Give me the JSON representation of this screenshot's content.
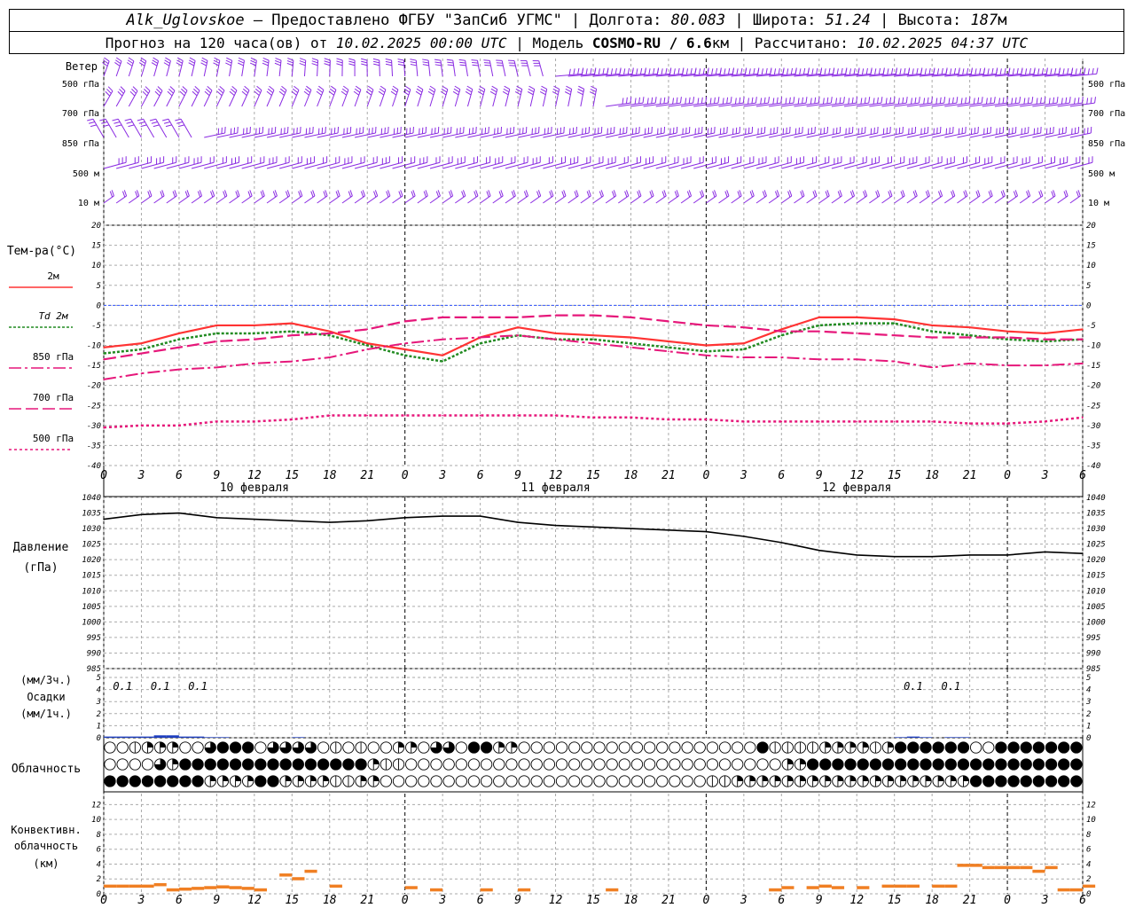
{
  "header": {
    "station": "Alk_Uglovskoe",
    "provider": "– Предоставлено ФГБУ \"ЗапСиб УГМС\" |",
    "lon_label": "Долгота:",
    "lon_value": "80.083",
    "lat_label": "| Широта:",
    "lat_value": "51.24",
    "alt_label": "| Высота:",
    "alt_value": "187",
    "alt_unit": "м",
    "forecast_label": "Прогноз на 120 часа(ов) от",
    "forecast_from": "10.02.2025 00:00 UTC",
    "model_label": "| Модель",
    "model_name": "COSMO-RU / 6.6",
    "model_unit": "км",
    "calc_label": "| Рассчитано:",
    "calc_time": "10.02.2025 04:37 UTC"
  },
  "wind": {
    "title": "Ветер",
    "levels": [
      "500 гПа",
      "700 гПа",
      "850 гПа",
      "500 м",
      "10  м"
    ]
  },
  "temp_panel": {
    "title": "Тем-ра(°С)",
    "legend": [
      {
        "label": "2м",
        "color": "#ff3333",
        "dash": "none"
      },
      {
        "label": "Td 2м",
        "color": "#228b22",
        "dash": "3,2"
      },
      {
        "label": "850 гПа",
        "color": "#e6177a",
        "dash": "14,4,3,4"
      },
      {
        "label": "700 гПа",
        "color": "#e6177a",
        "dash": "14,5"
      },
      {
        "label": "500 гПа",
        "color": "#e6177a",
        "dash": "3,3"
      }
    ],
    "yticks": [
      "20",
      "15",
      "10",
      "5",
      "0",
      "-5",
      "-10",
      "-15",
      "-20",
      "-25",
      "-30",
      "-35",
      "-40"
    ]
  },
  "time_axis": {
    "hours": [
      "0",
      "3",
      "6",
      "9",
      "12",
      "15",
      "18",
      "21",
      "0",
      "3",
      "6",
      "9",
      "12",
      "15",
      "18",
      "21",
      "0",
      "3",
      "6",
      "9",
      "12",
      "15",
      "18",
      "21",
      "0",
      "3",
      "6"
    ],
    "days": [
      "10 февраля",
      "11 февраля",
      "12 февраля"
    ]
  },
  "pressure_panel": {
    "title": "Давление",
    "unit": "(гПа)",
    "yticks": [
      "1040",
      "1035",
      "1030",
      "1025",
      "1020",
      "1015",
      "1010",
      "1005",
      "1000",
      "995",
      "990",
      "985"
    ]
  },
  "precip_panel": {
    "label1": "(мм/3ч.)",
    "label2": "Осадки",
    "label3": "(мм/1ч.)",
    "yticks": [
      "5",
      "4",
      "3",
      "2",
      "1",
      "0"
    ],
    "amounts": [
      {
        "hour": 1.5,
        "text": "0.1"
      },
      {
        "hour": 4.5,
        "text": "0.1"
      },
      {
        "hour": 7.5,
        "text": "0.1"
      },
      {
        "hour": 64.5,
        "text": "0.1"
      },
      {
        "hour": 67.5,
        "text": "0.1"
      }
    ]
  },
  "cloud_panel": {
    "title": "Облачность"
  },
  "conv_panel": {
    "title1": "Конвективн.",
    "title2": "облачность",
    "title3": "(км)",
    "yticks": [
      "12",
      "10",
      "8",
      "6",
      "4",
      "2",
      "0"
    ]
  },
  "chart_data": [
    {
      "type": "line",
      "title": "Тем-ра(°С)",
      "x_unit": "hours from 10.02.2025 00:00 UTC",
      "ylim": [
        -40,
        20
      ],
      "series": [
        {
          "name": "2м",
          "x": [
            0,
            3,
            6,
            9,
            12,
            15,
            18,
            21,
            24,
            27,
            30,
            33,
            36,
            39,
            42,
            45,
            48,
            51,
            54,
            57,
            60,
            63,
            66,
            69,
            72,
            75,
            78
          ],
          "values": [
            -10.5,
            -9.5,
            -7,
            -5,
            -5,
            -4.5,
            -6.5,
            -9.5,
            -11,
            -12.5,
            -8,
            -5.5,
            -7,
            -7.5,
            -8,
            -9,
            -10,
            -9.5,
            -6,
            -3,
            -3,
            -3.5,
            -5,
            -5.5,
            -6.5,
            -7,
            -6
          ]
        },
        {
          "name": "Td 2м",
          "x": [
            0,
            3,
            6,
            9,
            12,
            15,
            18,
            21,
            24,
            27,
            30,
            33,
            36,
            39,
            42,
            45,
            48,
            51,
            54,
            57,
            60,
            63,
            66,
            69,
            72,
            75,
            78
          ],
          "values": [
            -12,
            -11,
            -8.5,
            -7,
            -7,
            -6.5,
            -7.5,
            -10,
            -12.5,
            -14,
            -9.5,
            -7.5,
            -8.5,
            -8.5,
            -9.5,
            -10.5,
            -11.5,
            -11,
            -7.5,
            -5,
            -4.5,
            -4.5,
            -6.5,
            -7.5,
            -8.5,
            -9,
            -8.5
          ]
        },
        {
          "name": "850 гПа",
          "x": [
            0,
            3,
            6,
            9,
            12,
            15,
            18,
            21,
            24,
            27,
            30,
            33,
            36,
            39,
            42,
            45,
            48,
            51,
            54,
            57,
            60,
            63,
            66,
            69,
            72,
            75,
            78
          ],
          "values": [
            -18.5,
            -17,
            -16,
            -15.5,
            -14.5,
            -14,
            -13,
            -11,
            -9.5,
            -8.5,
            -8,
            -7.5,
            -8.5,
            -9.5,
            -10.5,
            -11.5,
            -12.5,
            -13,
            -13,
            -13.5,
            -13.5,
            -14,
            -15.5,
            -14.5,
            -15,
            -15,
            -14.5
          ]
        },
        {
          "name": "700 гПа",
          "x": [
            0,
            3,
            6,
            9,
            12,
            15,
            18,
            21,
            24,
            27,
            30,
            33,
            36,
            39,
            42,
            45,
            48,
            51,
            54,
            57,
            60,
            63,
            66,
            69,
            72,
            75,
            78
          ],
          "values": [
            -13.5,
            -12,
            -10.5,
            -9,
            -8.5,
            -7.5,
            -7,
            -6,
            -4,
            -3,
            -3,
            -3,
            -2.5,
            -2.5,
            -3,
            -4,
            -5,
            -5.5,
            -6.5,
            -6.5,
            -7,
            -7.5,
            -8,
            -8,
            -8,
            -8.5,
            -8.5
          ]
        },
        {
          "name": "500 гПа",
          "x": [
            0,
            3,
            6,
            9,
            12,
            15,
            18,
            21,
            24,
            27,
            30,
            33,
            36,
            39,
            42,
            45,
            48,
            51,
            54,
            57,
            60,
            63,
            66,
            69,
            72,
            75,
            78
          ],
          "values": [
            -30.5,
            -30,
            -30,
            -29,
            -29,
            -28.5,
            -27.5,
            -27.5,
            -27.5,
            -27.5,
            -27.5,
            -27.5,
            -27.5,
            -28,
            -28,
            -28.5,
            -28.5,
            -29,
            -29,
            -29,
            -29,
            -29,
            -29,
            -29.5,
            -29.5,
            -29,
            -28
          ]
        }
      ]
    },
    {
      "type": "line",
      "title": "Давление",
      "ylim": [
        985,
        1040
      ],
      "series": [
        {
          "x": [
            0,
            3,
            6,
            9,
            12,
            15,
            18,
            21,
            24,
            27,
            30,
            33,
            36,
            39,
            42,
            45,
            48,
            51,
            54,
            57,
            60,
            63,
            66,
            69,
            72,
            75,
            78
          ],
          "values": [
            1033,
            1034.5,
            1035,
            1033.5,
            1033,
            1032.5,
            1032,
            1032.5,
            1033.5,
            1034,
            1034,
            1032,
            1031,
            1030.5,
            1030,
            1029.5,
            1029,
            1027.5,
            1025.5,
            1023,
            1021.5,
            1021,
            1021,
            1021.5,
            1021.5,
            1022.5,
            1022
          ]
        }
      ]
    },
    {
      "type": "bar",
      "title": "Осадки",
      "ylim": [
        0,
        5
      ],
      "x": [
        0,
        1,
        2,
        3,
        4,
        5,
        6,
        7,
        8,
        9,
        10,
        11,
        12,
        13,
        14,
        15,
        63,
        64,
        65,
        66,
        67,
        68
      ],
      "values": [
        0.1,
        0.1,
        0.1,
        0.1,
        0.2,
        0.2,
        0.1,
        0.1,
        0.05,
        0.05,
        0,
        0,
        0,
        0,
        0,
        0.05,
        0.05,
        0.1,
        0.05,
        0,
        0.05,
        0.05
      ]
    },
    {
      "type": "bar",
      "title": "Конвективн. облачность",
      "ylim": [
        0,
        13
      ],
      "x": [
        0,
        1,
        2,
        3,
        4,
        5,
        6,
        7,
        8,
        9,
        10,
        11,
        12,
        13,
        14,
        15,
        16,
        18,
        24,
        26,
        30,
        33,
        40,
        53,
        54,
        56,
        57,
        58,
        60,
        62,
        63,
        64,
        66,
        67,
        68,
        69,
        70,
        71,
        72,
        73,
        74,
        75,
        76,
        77,
        78
      ],
      "values": [
        1,
        1,
        1,
        1,
        1.2,
        0.5,
        0.6,
        0.7,
        0.8,
        0.9,
        0.8,
        0.7,
        0.5,
        0,
        2.5,
        2,
        3,
        1,
        0.8,
        0.5,
        0.5,
        0.5,
        0.5,
        0.5,
        0.8,
        0.8,
        1,
        0.8,
        0.8,
        1,
        1,
        1,
        1,
        1,
        3.8,
        3.8,
        3.5,
        3.5,
        3.5,
        3.5,
        3,
        3.5,
        0.5,
        0.5,
        1
      ]
    }
  ]
}
